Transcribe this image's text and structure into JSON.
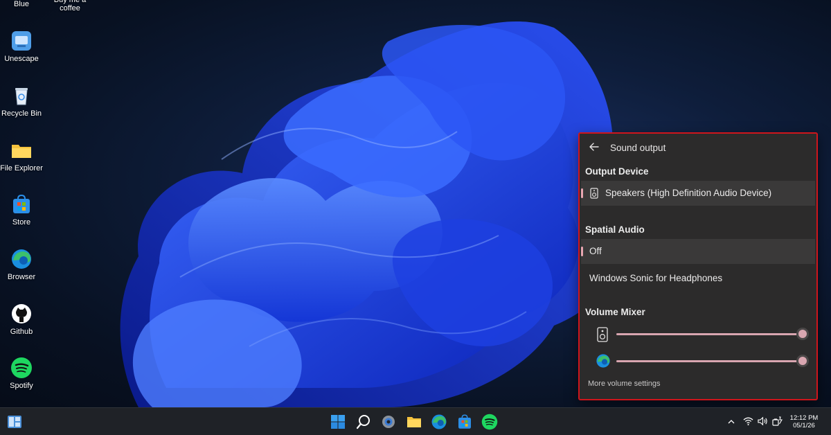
{
  "desktop": {
    "icons": [
      {
        "label": "Blue",
        "icon": "blue-app-icon"
      },
      {
        "label": "Buy me a coffee",
        "icon": "coffee-icon"
      },
      {
        "label": "Unescape",
        "icon": "unescape-app-icon"
      },
      {
        "label": "Recycle Bin",
        "icon": "recycle-bin-icon"
      },
      {
        "label": "File Explorer",
        "icon": "folder-icon"
      },
      {
        "label": "Store",
        "icon": "store-icon"
      },
      {
        "label": "Browser",
        "icon": "edge-browser-icon"
      },
      {
        "label": "Github",
        "icon": "github-icon"
      },
      {
        "label": "Spotify",
        "icon": "spotify-icon"
      }
    ]
  },
  "sound_panel": {
    "title": "Sound output",
    "output_device": {
      "heading": "Output Device",
      "selected": "Speakers (High Definition Audio Device)"
    },
    "spatial_audio": {
      "heading": "Spatial Audio",
      "options": [
        "Off",
        "Windows Sonic for Headphones"
      ],
      "selected": "Off"
    },
    "volume_mixer": {
      "heading": "Volume Mixer",
      "items": [
        {
          "icon": "speaker-icon",
          "level_fraction": 1.0
        },
        {
          "icon": "edge-browser-icon",
          "level_fraction": 1.0
        }
      ]
    },
    "more_link": "More volume settings",
    "accent_color": "#d9a6b0",
    "border_color": "#d0151b"
  },
  "taskbar": {
    "apps": [
      "widgets-icon",
      "start-icon",
      "search-icon",
      "settings-icon",
      "file-explorer-icon",
      "edge-browser-icon",
      "store-icon",
      "spotify-icon"
    ],
    "tray": [
      "chevron-up-icon",
      "wifi-icon",
      "volume-icon",
      "battery-icon"
    ],
    "time": "12:12 PM",
    "date": "05/1/26"
  }
}
